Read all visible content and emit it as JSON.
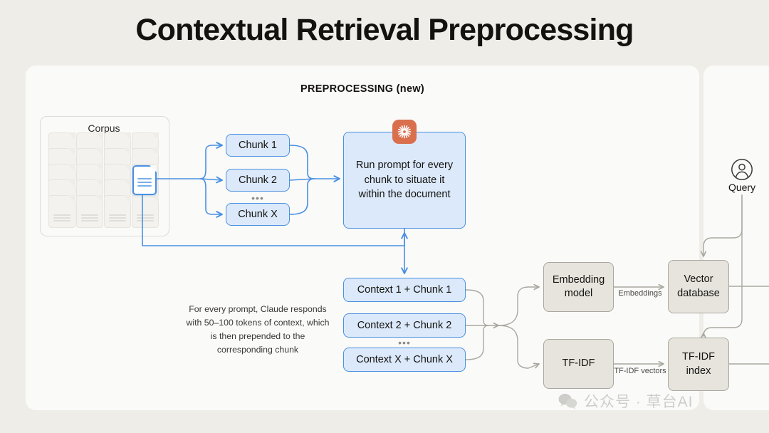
{
  "page": {
    "title": "Contextual Retrieval Preprocessing",
    "background_color": "#efede8"
  },
  "panels": {
    "preprocessing": {
      "section_label": "PREPROCESSING (new)",
      "background_color": "#fafaf8"
    },
    "retrieval": {
      "background_color": "#fafaf8"
    }
  },
  "corpus": {
    "label": "Corpus",
    "ghost_doc_columns": 4,
    "ghost_docs_per_column": 5,
    "active_doc_icon": "document-icon"
  },
  "chunks": {
    "items": [
      {
        "label": "Chunk 1"
      },
      {
        "label": "Chunk 2"
      },
      {
        "label": "Chunk X"
      }
    ],
    "ellipsis": "•••"
  },
  "prompt": {
    "icon": "claude-starburst-icon",
    "icon_color": "#d96f4d",
    "text": "Run prompt for every chunk to situate it within the document"
  },
  "contexts": {
    "items": [
      {
        "label": "Context 1 + Chunk 1"
      },
      {
        "label": "Context 2 + Chunk 2"
      },
      {
        "label": "Context X + Chunk X"
      }
    ],
    "ellipsis": "•••"
  },
  "notes": {
    "prepend": "For every prompt, Claude responds with 50–100 tokens of context, which is then prepended to the corresponding chunk"
  },
  "indexing": {
    "embedding_model": "Embedding model",
    "tfidf": "TF-IDF",
    "vector_database": "Vector database",
    "tfidf_index": "TF-IDF index",
    "edge_labels": {
      "embeddings": "Embeddings",
      "tfidf_vectors": "TF-IDF vectors"
    }
  },
  "query": {
    "label": "Query",
    "icon": "user-avatar-icon"
  },
  "watermark": {
    "text": "公众号 · 草台AI",
    "icon": "wechat-icon"
  },
  "colors": {
    "blue_fill": "#dbe9fa",
    "blue_stroke": "#4a90e2",
    "gray_fill": "#e6e4dd",
    "gray_stroke": "#a9a79f",
    "accent_orange": "#d96f4d"
  }
}
